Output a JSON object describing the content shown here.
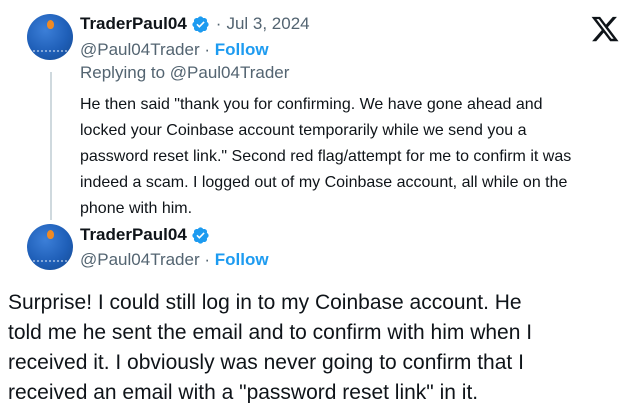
{
  "tweet1": {
    "display_name": "TraderPaul04",
    "separator": "·",
    "date": "Jul 3, 2024",
    "handle": "@Paul04Trader",
    "handle_separator": " · ",
    "follow_label": "Follow",
    "replying_to": "Replying to @Paul04Trader",
    "body_lines": [
      "He then said \"thank you for confirming. We have gone ahead and",
      "locked your Coinbase account temporarily while we send you a",
      "password reset link.\" Second red flag/attempt for me to confirm it was",
      "indeed a scam. I logged out of my Coinbase account, all while on the",
      "phone with him."
    ]
  },
  "tweet2": {
    "display_name": "TraderPaul04",
    "handle": "@Paul04Trader",
    "handle_separator": " · ",
    "follow_label": "Follow",
    "body_lines": [
      "Surprise! I could still log in to my Coinbase account. He",
      "told me he sent the email and to confirm with him when I",
      "received it. I obviously was never going to confirm that I",
      "received an email with a \"password reset link\" in it."
    ]
  },
  "icons": {
    "verified": "verified-badge-icon",
    "brand": "x-logo-icon"
  },
  "colors": {
    "accent": "#1d9bf0",
    "secondary_text": "#536471",
    "primary_text": "#0f1419",
    "thread_line": "#cfd9de"
  }
}
